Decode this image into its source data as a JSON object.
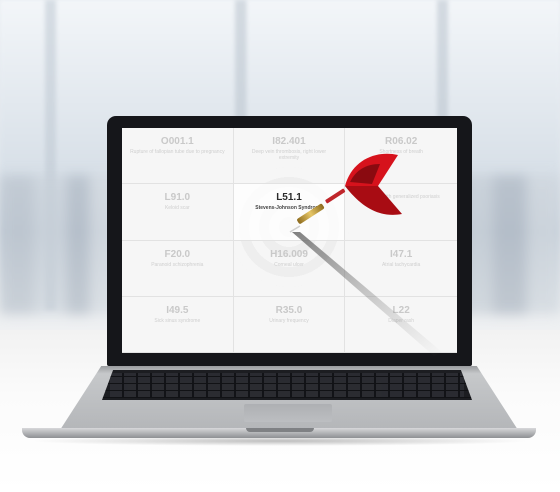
{
  "screen": {
    "cells": [
      {
        "code": "O001.1",
        "desc": "Rupture of fallopian tube due to pregnancy",
        "active": false
      },
      {
        "code": "I82.401",
        "desc": "Deep vein thrombosis, right lower extremity",
        "active": false
      },
      {
        "code": "R06.02",
        "desc": "Shortness of breath",
        "active": false
      },
      {
        "code": "L91.0",
        "desc": "Keloid scar",
        "active": false
      },
      {
        "code": "L51.1",
        "desc": "Stevens-Johnson Syndrome",
        "active": true
      },
      {
        "code": "",
        "desc": "…ments with generalized psoriasis",
        "active": false
      },
      {
        "code": "F20.0",
        "desc": "Paranoid schizophrenia",
        "active": false
      },
      {
        "code": "H16.009",
        "desc": "Corneal ulcer",
        "active": false
      },
      {
        "code": "I47.1",
        "desc": "Atrial tachycardia",
        "active": false
      },
      {
        "code": "I49.5",
        "desc": "Sick sinus syndrome",
        "active": false
      },
      {
        "code": "R35.0",
        "desc": "Urinary frequency",
        "active": false
      },
      {
        "code": "L22",
        "desc": "Diaper rash",
        "active": false
      }
    ]
  },
  "colors": {
    "dart_flight": "#d6121c",
    "dart_barrel": "#c9a441",
    "bezel": "#15161a"
  }
}
